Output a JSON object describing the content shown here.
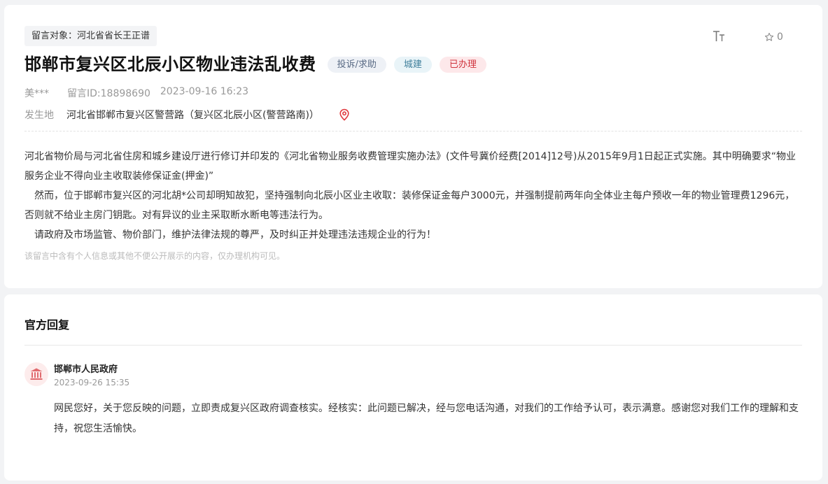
{
  "post": {
    "target": "留言对象：河北省省长王正谱",
    "favorite_count": "0",
    "title": "邯郸市复兴区北辰小区物业违法乱收费",
    "badges": {
      "type": "投诉/求助",
      "field": "城建",
      "status": "已办理"
    },
    "author": "美***",
    "message_id": "留言ID:18898690",
    "datetime": "2023-09-16 16:23",
    "location_label": "发生地",
    "location_value": "河北省邯郸市复兴区警营路（复兴区北辰小区(警营路南)）",
    "content": [
      "河北省物价局与河北省住房和城乡建设厅进行修订并印发的《河北省物业服务收费管理实施办法》(文件号冀价经费[2014]12号)从2015年9月1日起正式实施。其中明确要求“物业服务企业不得向业主收取装修保证金(押金)”",
      "然而，位于邯郸市复兴区的河北胡*公司却明知故犯，坚持强制向北辰小区业主收取：装修保证金每户3000元，并强制提前两年向全体业主每户预收一年的物业管理费1296元，否则就不给业主房门钥匙。对有异议的业主采取断水断电等违法行为。",
      "请政府及市场监管、物价部门，维护法律法规的尊严，及时纠正并处理违法违规企业的行为！"
    ],
    "privacy_note": "该留言中含有个人信息或其他不便公开展示的内容，仅办理机构可见。"
  },
  "reply": {
    "section_title": "官方回复",
    "org_name": "邯郸市人民政府",
    "datetime": "2023-09-26 15:35",
    "text": "网民您好，关于您反映的问题，立即责成复兴区政府调查核实。经核实：此问题已解决，经与您电话沟通，对我们的工作给予认可，表示满意。感谢您对我们工作的理解和支持，祝您生活愉快。"
  },
  "icons": {
    "font_size": "font-size-icon",
    "favorite": "star-icon",
    "location": "location-pin-icon",
    "government": "government-building-icon"
  },
  "colors": {
    "status_red": "#d0363f",
    "pin_red": "#e0393e",
    "avatar_bg": "#fdecec"
  }
}
